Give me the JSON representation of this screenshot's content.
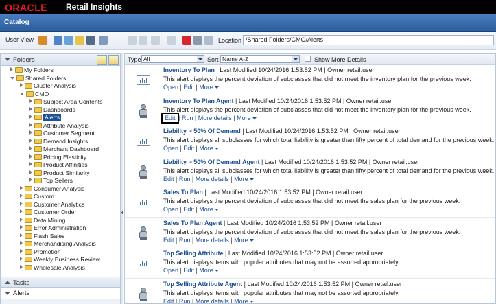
{
  "header": {
    "brand": "ORACLE",
    "product": "Retail Insights",
    "section": "Catalog"
  },
  "toolbar": {
    "user_view": "User View",
    "location_label": "Location",
    "location_value": "/Shared Folders/CMO/Alerts"
  },
  "folders_panel": {
    "title": "Folders",
    "tree": [
      {
        "label": "My Folders",
        "level": 0,
        "expanded": false
      },
      {
        "label": "Shared Folders",
        "level": 0,
        "expanded": true
      },
      {
        "label": "Cluster Analysis",
        "level": 1,
        "expanded": false
      },
      {
        "label": "CMO",
        "level": 1,
        "expanded": true
      },
      {
        "label": "Subject Area Contents",
        "level": 2,
        "expanded": false
      },
      {
        "label": "Dashboards",
        "level": 2,
        "expanded": false
      },
      {
        "label": "Alerts",
        "level": 2,
        "expanded": false,
        "selected": true
      },
      {
        "label": "Attribute Analysis",
        "level": 2,
        "expanded": false
      },
      {
        "label": "Customer Segment",
        "level": 2,
        "expanded": false
      },
      {
        "label": "Demand Insights",
        "level": 2,
        "expanded": false
      },
      {
        "label": "Merchant Dashboard",
        "level": 2,
        "expanded": false
      },
      {
        "label": "Pricing Elasticity",
        "level": 2,
        "expanded": false
      },
      {
        "label": "Product Affinities",
        "level": 2,
        "expanded": false
      },
      {
        "label": "Product Similarity",
        "level": 2,
        "expanded": false
      },
      {
        "label": "Top Sellers",
        "level": 2,
        "expanded": false
      },
      {
        "label": "Consumer Analysis",
        "level": 1,
        "expanded": false
      },
      {
        "label": "Custom",
        "level": 1,
        "expanded": false
      },
      {
        "label": "Customer Analytics",
        "level": 1,
        "expanded": false
      },
      {
        "label": "Customer Order",
        "level": 1,
        "expanded": false
      },
      {
        "label": "Data Mining",
        "level": 1,
        "expanded": false
      },
      {
        "label": "Error Administration",
        "level": 1,
        "expanded": false
      },
      {
        "label": "Flash Sales",
        "level": 1,
        "expanded": false
      },
      {
        "label": "Merchandising Analysis",
        "level": 1,
        "expanded": false
      },
      {
        "label": "Promotion",
        "level": 1,
        "expanded": false
      },
      {
        "label": "Weekly Business Review",
        "level": 1,
        "expanded": false
      },
      {
        "label": "Wholesale Analysis",
        "level": 1,
        "expanded": false
      }
    ],
    "tasks_title": "Tasks",
    "alerts_title": "Alerts"
  },
  "filter": {
    "type_label": "Type",
    "type_value": "All",
    "sort_label": "Sort",
    "sort_value": "Name A-Z",
    "show_more": "Show More Details"
  },
  "items": [
    {
      "name": "Inventory To Plan",
      "kind": "report",
      "modified": "| Last Modified 10/24/2016 1:53:52 PM | Owner retail.user",
      "desc": "This alert displays the percent deviation of subclasses that did not meet the inventory plan for the previous week.",
      "actions": [
        "Open",
        "Edit",
        "More"
      ]
    },
    {
      "name": "Inventory To Plan Agent",
      "kind": "agent",
      "modified": "| Last Modified 10/24/2016 1:53:52 PM | Owner retail.user",
      "desc": "This alert displays the percent deviation of subclasses that did not meet the inventory plan for the previous week.",
      "actions": [
        "Edit",
        "Run",
        "More details",
        "More"
      ],
      "highlight_first": true
    },
    {
      "name": "Liability > 50% Of Demand",
      "kind": "report",
      "modified": "| Last Modified 10/24/2016 1:53:52 PM | Owner retail.user",
      "desc": "This alert displays all subclasses for which total liability is greater than fifty percent of total demand for the previous week.",
      "actions": [
        "Open",
        "Edit",
        "More"
      ]
    },
    {
      "name": "Liability > 50% Of Demand Agent",
      "kind": "agent",
      "modified": "| Last Modified 10/24/2016 1:53:52 PM | Owner retail.user",
      "desc": "This alert displays all subclasses for which total liability is greater than fifty percent of total demand for the previous week.",
      "actions": [
        "Edit",
        "Run",
        "More details",
        "More"
      ]
    },
    {
      "name": "Sales To Plan",
      "kind": "report",
      "modified": "| Last Modified 10/24/2016 1:53:52 PM | Owner retail.user",
      "desc": "This alert displays the percent deviation of subclasses that did not meet the sales plan for the previous week.",
      "actions": [
        "Open",
        "Edit",
        "More"
      ]
    },
    {
      "name": "Sales To Plan Agent",
      "kind": "agent",
      "modified": "| Last Modified 10/24/2016 1:53:52 PM | Owner retail.user",
      "desc": "This alert displays the percent deviation of subclasses that did not meet the sales plan for the previous week.",
      "actions": [
        "Edit",
        "Run",
        "More details",
        "More"
      ]
    },
    {
      "name": "Top Selling Attribute",
      "kind": "report",
      "modified": "| Last Modified 10/24/2016 1:53:52 PM | Owner retail.user",
      "desc": "This alert displays items with popular attributes that may not be assorted appropriately.",
      "actions": [
        "Open",
        "Edit",
        "More"
      ]
    },
    {
      "name": "Top Selling Attribute Agent",
      "kind": "agent",
      "modified": "| Last Modified 10/24/2016 1:53:52 PM | Owner retail.user",
      "desc": "This alert displays items with popular attributes that may not be assorted appropriately.",
      "actions": [
        "Edit",
        "Run",
        "More details",
        "More"
      ]
    }
  ]
}
